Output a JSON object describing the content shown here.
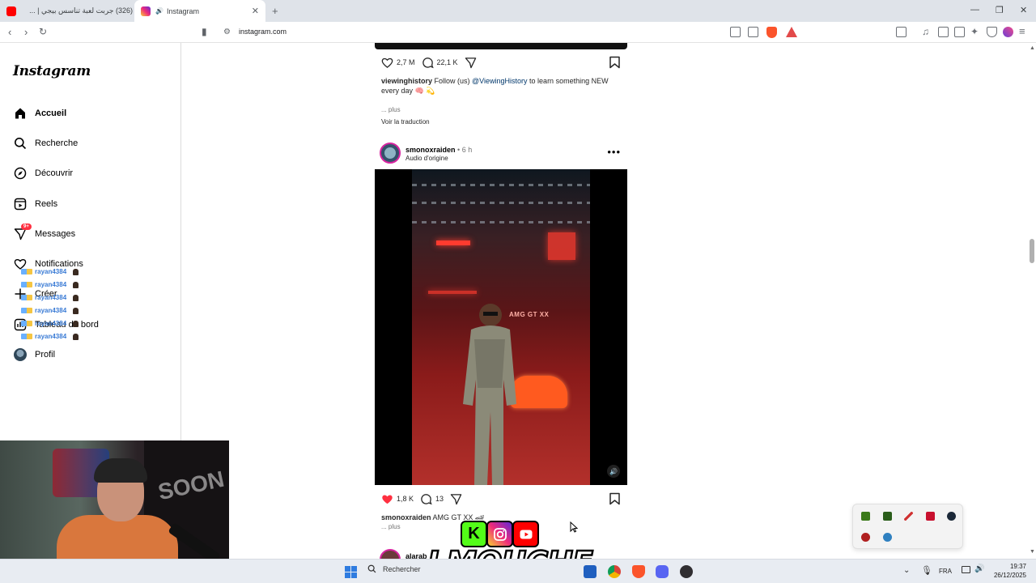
{
  "browser": {
    "tabs": [
      {
        "label": "(326) جربت لعبة تناسس بيجي | ...",
        "active": false
      },
      {
        "label": "Instagram",
        "active": true
      }
    ],
    "url": "instagram.com",
    "accent_color": "#fb542b"
  },
  "sidebar": {
    "logo": "Instagram",
    "items": [
      {
        "label": "Accueil",
        "icon": "home-icon"
      },
      {
        "label": "Recherche",
        "icon": "search-icon"
      },
      {
        "label": "Découvrir",
        "icon": "compass-icon"
      },
      {
        "label": "Reels",
        "icon": "reels-icon"
      },
      {
        "label": "Messages",
        "icon": "messenger-icon",
        "badge": "9+"
      },
      {
        "label": "Notifications",
        "icon": "heart-icon"
      },
      {
        "label": "Créer",
        "icon": "plus-icon"
      },
      {
        "label": "Tableau de bord",
        "icon": "dashboard-icon"
      },
      {
        "label": "Profil",
        "icon": "avatar-icon"
      }
    ]
  },
  "overlay_chat": {
    "lines": [
      "rayan4384",
      "rayan4384",
      "rayan4384",
      "rayan4384",
      "rayan4384",
      "rayan4384"
    ]
  },
  "post1": {
    "likes": "2,7 M",
    "comments": "22,1 K",
    "username": "viewinghistory",
    "caption_pre": "Follow (us) ",
    "mention": "@ViewingHistory",
    "caption_post": " to learn something NEW every day 🧠 💫",
    "more": "... plus",
    "translate": "Voir la traduction"
  },
  "post2": {
    "username": "smonoxraiden",
    "time": "6 h",
    "audio": "Audio d'origine",
    "media_text": "AMG GT XX",
    "likes": "1,8 K",
    "comments": "13",
    "caption": "AMG GT XX 🏎",
    "more": "... plus"
  },
  "post3": {
    "username": "alarab"
  },
  "stream": {
    "brand": "LMOUCHE",
    "kick_letter": "K",
    "webcam_wall_text": "SOON"
  },
  "taskbar": {
    "search_placeholder": "Rechercher",
    "lang": "FRA",
    "time": "19:37",
    "date": "26/12/2025"
  }
}
